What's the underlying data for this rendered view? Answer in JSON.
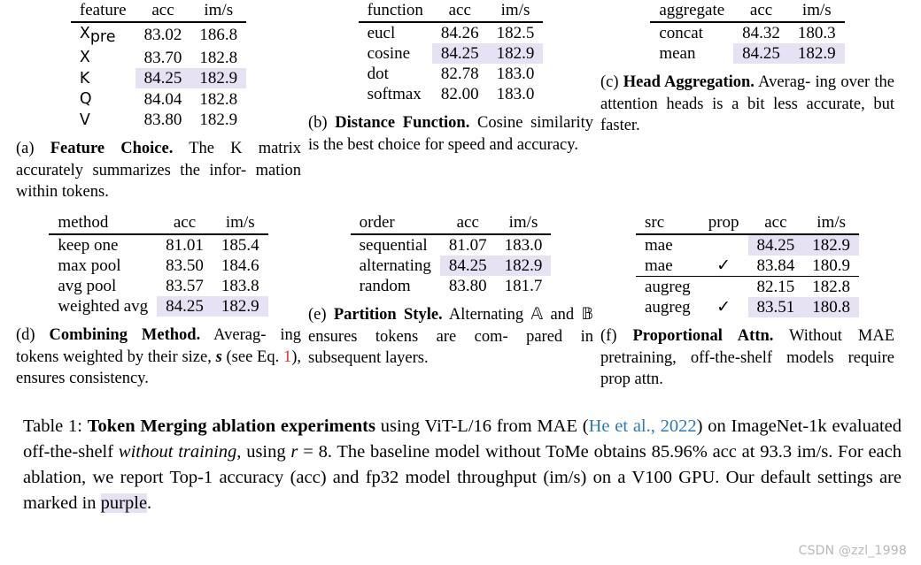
{
  "tables": [
    {
      "id": "a",
      "headers": [
        "feature",
        "acc",
        "im/s"
      ],
      "rows": [
        {
          "label": "X<sub>pre</sub>",
          "acc": "83.02",
          "ims": "186.8"
        },
        {
          "label": "X",
          "acc": "83.70",
          "ims": "182.8"
        },
        {
          "label": "K",
          "acc": "84.25",
          "ims": "182.9"
        },
        {
          "label": "Q",
          "acc": "84.04",
          "ims": "182.8"
        },
        {
          "label": "V",
          "acc": "83.80",
          "ims": "182.9"
        }
      ],
      "caption_tag": "(a)",
      "caption_title": "Feature Choice.",
      "caption_body": "The K matrix accurately summarizes the infor-mation within tokens."
    },
    {
      "id": "b",
      "headers": [
        "function",
        "acc",
        "im/s"
      ],
      "rows": [
        {
          "label": "eucl",
          "acc": "84.26",
          "ims": "182.5"
        },
        {
          "label": "cosine",
          "acc": "84.25",
          "ims": "182.9"
        },
        {
          "label": "dot",
          "acc": "82.78",
          "ims": "183.0"
        },
        {
          "label": "softmax",
          "acc": "82.00",
          "ims": "183.0"
        }
      ],
      "caption_tag": "(b)",
      "caption_title": "Distance Function.",
      "caption_body": "Cosine similarity is the best choice for speed and accuracy."
    },
    {
      "id": "c",
      "headers": [
        "aggregate",
        "acc",
        "im/s"
      ],
      "rows": [
        {
          "label": "concat",
          "acc": "84.32",
          "ims": "180.3"
        },
        {
          "label": "mean",
          "acc": "84.25",
          "ims": "182.9"
        }
      ],
      "caption_tag": "(c)",
      "caption_title": "Head Aggregation.",
      "caption_body": "Averaging over the attention heads is a bit less accurate, but faster."
    },
    {
      "id": "d",
      "headers": [
        "method",
        "acc",
        "im/s"
      ],
      "rows": [
        {
          "label": "keep one",
          "acc": "81.01",
          "ims": "185.4"
        },
        {
          "label": "max pool",
          "acc": "83.50",
          "ims": "184.6"
        },
        {
          "label": "avg pool",
          "acc": "83.57",
          "ims": "183.8"
        },
        {
          "label": "weighted avg",
          "acc": "84.25",
          "ims": "182.9"
        }
      ],
      "caption_tag": "(d)",
      "caption_title": "Combining Method.",
      "caption_body": "Averaging tokens weighted by their size, s (see Eq. 1), ensures consistency."
    },
    {
      "id": "e",
      "headers": [
        "order",
        "acc",
        "im/s"
      ],
      "rows": [
        {
          "label": "sequential",
          "acc": "81.07",
          "ims": "183.0"
        },
        {
          "label": "alternating",
          "acc": "84.25",
          "ims": "182.9"
        },
        {
          "label": "random",
          "acc": "83.80",
          "ims": "181.7"
        }
      ],
      "caption_tag": "(e)",
      "caption_title": "Partition Style.",
      "caption_body": "Alternating A and B ensures tokens are com-pared in subsequent layers."
    },
    {
      "id": "f",
      "headers": [
        "src",
        "prop",
        "acc",
        "im/s"
      ],
      "rows": [
        {
          "label": "mae",
          "prop": "",
          "acc": "84.25",
          "ims": "182.9"
        },
        {
          "label": "mae",
          "prop": "✓",
          "acc": "83.84",
          "ims": "180.9"
        },
        {
          "label": "augreg",
          "prop": "",
          "acc": "82.15",
          "ims": "182.8"
        },
        {
          "label": "augreg",
          "prop": "✓",
          "acc": "83.51",
          "ims": "180.8"
        }
      ],
      "caption_tag": "(f)",
      "caption_title": "Proportional Attn.",
      "caption_body": "Without MAE pretraining, off-the-shelf models require prop attn."
    }
  ],
  "captions": {
    "a": {
      "tag": "(a) ",
      "title": "Feature Choice.",
      "l1_rest": " The K matrix",
      "l2": "accurately summarizes the infor-",
      "l3": "mation within tokens."
    },
    "b": {
      "tag": "(b) ",
      "title": "Distance Function.",
      "l1_rest": "  Cosine",
      "l2": "similarity is the best choice for",
      "l3": "speed and accuracy."
    },
    "c": {
      "tag": "(c) ",
      "title": "Head Aggregation.",
      "l1_rest": "  Averag-",
      "l2": "ing over the attention heads is a",
      "l3": "bit less accurate, but faster."
    },
    "d": {
      "tag": "(d) ",
      "title": "Combining Method.",
      "l1_rest": " Averag-",
      "l2": "ing tokens weighted by their size,",
      "l3_a": "s",
      "l3_b": " (see Eq. ",
      "l3_ref": "1",
      "l3_c": "), ensures consistency."
    },
    "e": {
      "tag": "(e) ",
      "title": "Partition Style.",
      "l1_rest": "  Alternating",
      "l2_a": "𝔸",
      "l2_b": " and ",
      "l2_c": "𝔹",
      "l2_d": " ensures tokens are com-",
      "l3": "pared in subsequent layers."
    },
    "f": {
      "tag": "(f) ",
      "title": "Proportional Attn.",
      "l1_rest": "  Without",
      "l2": "MAE  pretraining,   off-the-shelf",
      "l3": "models require prop attn."
    }
  },
  "main_caption": {
    "label": "Table 1: ",
    "bold_lead": "Token Merging ablation experiments",
    "seg1": " using ViT-L/16 from MAE (",
    "citation": "He et al., 2022",
    "seg2": ") on ImageNet-1k evaluated off-the-shelf ",
    "italic1": "without training",
    "seg3": ", using ",
    "math_r": "r",
    "math_eq": " = ",
    "math_val": "8",
    "seg4": ". The baseline model without ToMe obtains 85.96% acc at 93.3 im/s. For each ablation, we report Top-1 accuracy (acc) and fp32 model throughput (im/s) on a V100 GPU. Our default settings are marked in ",
    "highlight_word": "purple",
    "seg5": "."
  },
  "watermark": "CSDN @zzl_1998",
  "colors": {
    "highlight_purple": "#e7e2f3",
    "link_blue": "#2a7ab9",
    "ref_red": "#e03030",
    "watermark_gray": "#b8b8b8"
  }
}
